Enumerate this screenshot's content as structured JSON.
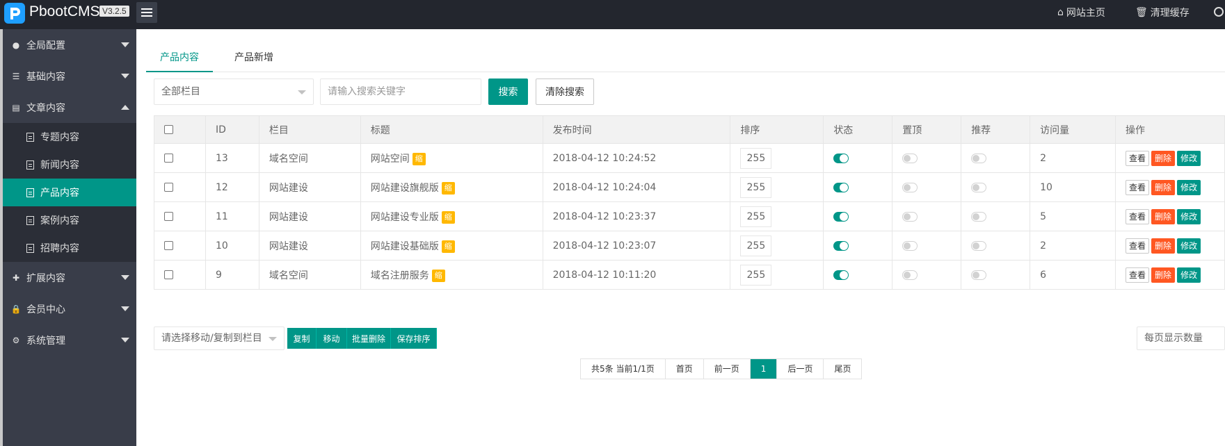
{
  "header": {
    "logo_text": "PbootCMS",
    "version": "V3.2.5",
    "home_link": "网站主页",
    "clear_cache": "清理缓存"
  },
  "sidebar": {
    "groups": [
      {
        "label": "全局配置",
        "icon": "globe-icon"
      },
      {
        "label": "基础内容",
        "icon": "sliders-icon"
      },
      {
        "label": "文章内容",
        "icon": "file-icon"
      },
      {
        "label": "扩展内容",
        "icon": "puzzle-icon"
      },
      {
        "label": "会员中心",
        "icon": "lock-icon"
      },
      {
        "label": "系统管理",
        "icon": "cog-icon"
      }
    ],
    "sub_items": [
      {
        "label": "专题内容"
      },
      {
        "label": "新闻内容"
      },
      {
        "label": "产品内容"
      },
      {
        "label": "案例内容"
      },
      {
        "label": "招聘内容"
      }
    ]
  },
  "tabs": [
    "产品内容",
    "产品新增"
  ],
  "search": {
    "category_select": "全部栏目",
    "keyword_placeholder": "请输入搜索关键字",
    "search_btn": "搜索",
    "clear_btn": "清除搜索"
  },
  "table": {
    "columns": [
      "ID",
      "栏目",
      "标题",
      "发布时间",
      "排序",
      "状态",
      "置顶",
      "推荐",
      "访问量",
      "操作"
    ],
    "badge": "缩",
    "actions": {
      "view": "查看",
      "delete": "删除",
      "edit": "修改"
    },
    "rows": [
      {
        "id": "13",
        "category": "域名空间",
        "title": "网站空间",
        "time": "2018-04-12 10:24:52",
        "sort": "255",
        "status": true,
        "top": false,
        "rec": false,
        "visits": "2"
      },
      {
        "id": "12",
        "category": "网站建设",
        "title": "网站建设旗舰版",
        "time": "2018-04-12 10:24:04",
        "sort": "255",
        "status": true,
        "top": false,
        "rec": false,
        "visits": "10"
      },
      {
        "id": "11",
        "category": "网站建设",
        "title": "网站建设专业版",
        "time": "2018-04-12 10:23:37",
        "sort": "255",
        "status": true,
        "top": false,
        "rec": false,
        "visits": "5"
      },
      {
        "id": "10",
        "category": "网站建设",
        "title": "网站建设基础版",
        "time": "2018-04-12 10:23:07",
        "sort": "255",
        "status": true,
        "top": false,
        "rec": false,
        "visits": "2"
      },
      {
        "id": "9",
        "category": "域名空间",
        "title": "域名注册服务",
        "time": "2018-04-12 10:11:20",
        "sort": "255",
        "status": true,
        "top": false,
        "rec": false,
        "visits": "6"
      }
    ]
  },
  "batch": {
    "move_select": "请选择移动/复制到栏目",
    "copy": "复制",
    "move": "移动",
    "batch_delete": "批量删除",
    "save_sort": "保存排序",
    "per_page": "每页显示数量"
  },
  "pager": {
    "info": "共5条 当前1/1页",
    "first": "首页",
    "prev": "前一页",
    "current": "1",
    "next": "后一页",
    "last": "尾页"
  },
  "colors": {
    "accent": "#009688",
    "danger": "#ff5722",
    "badge": "#ffb800",
    "header_bg": "#23262e",
    "sidebar_bg": "#393d49"
  }
}
